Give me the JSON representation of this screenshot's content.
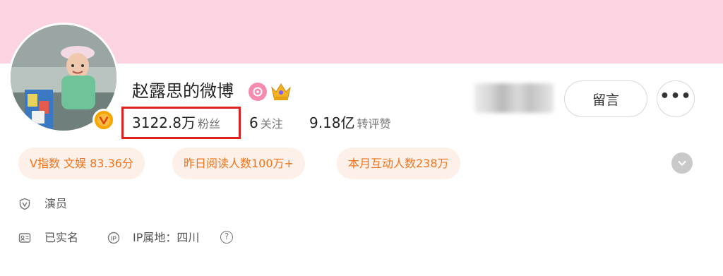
{
  "profile": {
    "name": "赵露思的微博",
    "stats": [
      {
        "value": "3122.8万",
        "label": "粉丝"
      },
      {
        "value": "6",
        "label": "关注"
      },
      {
        "value": "9.18亿",
        "label": "转评赞"
      }
    ]
  },
  "actions": {
    "message_label": "留言",
    "more_label": "•••"
  },
  "tags": [
    "V指数 文娱 83.36分",
    "昨日阅读人数100万+",
    "本月互动人数238万"
  ],
  "info": {
    "occupation": "演员",
    "verification": "已实名",
    "ip_location": "IP属地：四川",
    "help_symbol": "?"
  },
  "icons": {
    "verified": "verified-v-icon",
    "rank": "rank-badge-icon",
    "crown": "crown-badge-icon",
    "expand": "chevron-down-icon",
    "shield": "shield-v-icon",
    "id_card": "id-card-icon",
    "ip": "ip-icon",
    "help": "help-circle-icon"
  },
  "colors": {
    "cover": "#fcd3e1",
    "tag_bg": "#fdf0e8",
    "tag_text": "#f0741d",
    "verified_badge": "#f7a600",
    "highlight_border": "#e02020"
  }
}
